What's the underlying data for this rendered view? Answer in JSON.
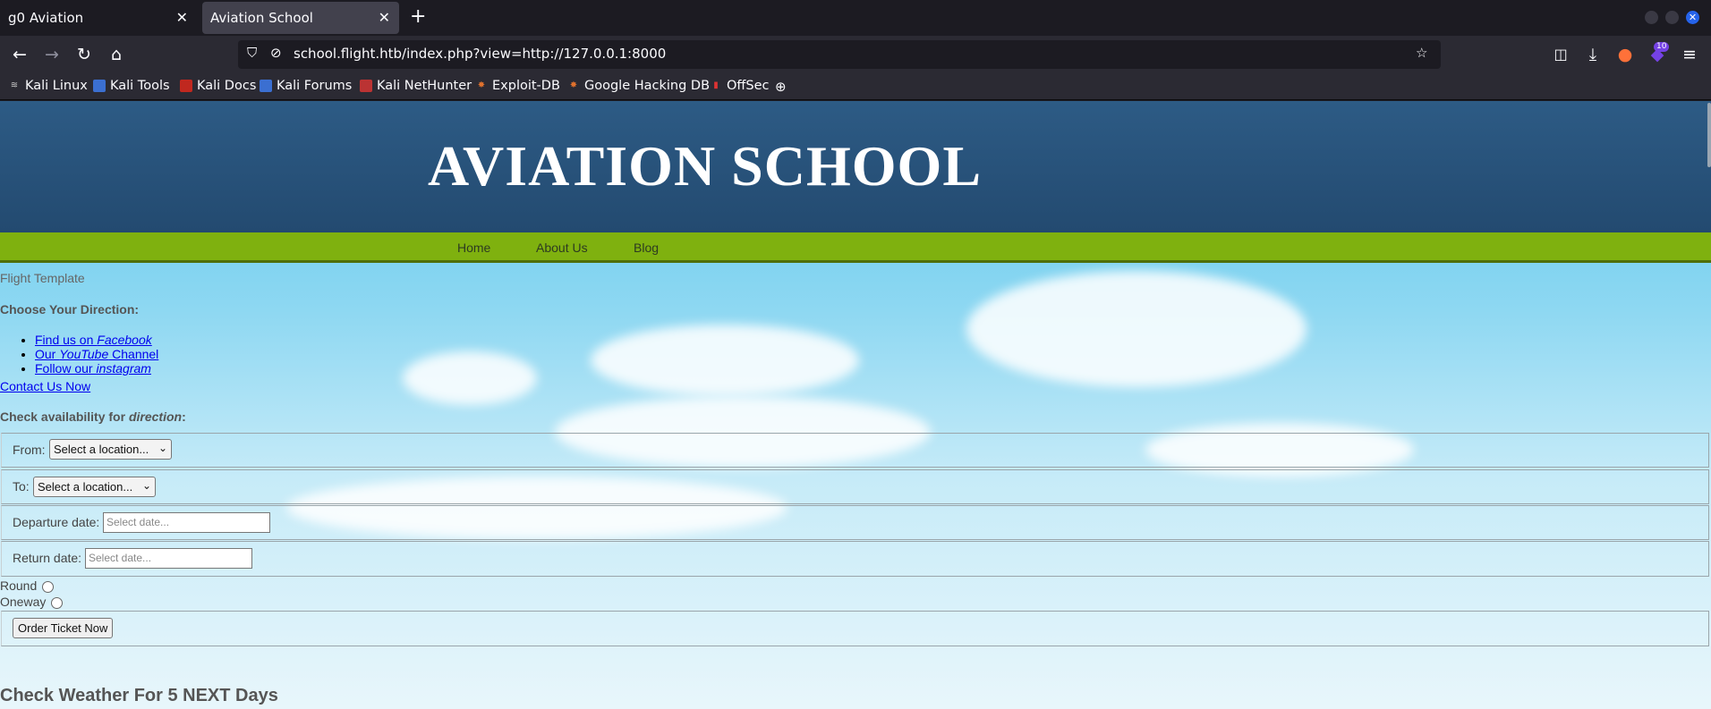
{
  "browser": {
    "tabs": [
      {
        "label": "g0 Aviation",
        "active": false
      },
      {
        "label": "Aviation School",
        "active": true
      }
    ],
    "close_glyph": "✕",
    "new_tab_glyph": "+",
    "url": "school.flight.htb/index.php?view=http://127.0.0.1:8000",
    "extension_badge": "10",
    "bookmarks": [
      {
        "label": "Kali Linux",
        "icon": "kali-icon"
      },
      {
        "label": "Kali Tools",
        "icon": "kali-tools-icon"
      },
      {
        "label": "Kali Docs",
        "icon": "kali-docs-icon"
      },
      {
        "label": "Kali Forums",
        "icon": "kali-forums-icon"
      },
      {
        "label": "Kali NetHunter",
        "icon": "nethunter-icon"
      },
      {
        "label": "Exploit-DB",
        "icon": "exploitdb-icon"
      },
      {
        "label": "Google Hacking DB",
        "icon": "ghdb-icon"
      },
      {
        "label": "OffSec",
        "icon": "offsec-icon"
      }
    ]
  },
  "site": {
    "title": "AVIATION SCHOOL",
    "nav": [
      "Home",
      "About Us",
      "Blog"
    ],
    "template_label": "Flight Template",
    "choose_heading": "Choose Your Direction:",
    "links": [
      {
        "prefix": "Find us on ",
        "emph": "Facebook",
        "suffix": ""
      },
      {
        "prefix": "Our ",
        "emph": "YouTube",
        "suffix": " Channel"
      },
      {
        "prefix": "Follow our ",
        "emph": "instagram",
        "suffix": ""
      }
    ],
    "contact": "Contact Us Now",
    "check_prefix": "Check availability for ",
    "check_emph": "direction",
    "check_suffix": ":",
    "form": {
      "from_label": "From:",
      "from_value": "Select a location...",
      "to_label": "To:",
      "to_value": "Select a location...",
      "departure_label": "Departure date:",
      "departure_placeholder": "Select date...",
      "return_label": "Return date:",
      "return_placeholder": "Select date...",
      "round_label": "Round",
      "oneway_label": "Oneway",
      "order_button": "Order Ticket Now"
    },
    "weather_heading": "Check Weather For 5 NEXT Days"
  },
  "colors": {
    "header": "#2d5b85",
    "nav": "#7fb10f",
    "sky": "#57c7eb",
    "link": "#0000ee"
  }
}
